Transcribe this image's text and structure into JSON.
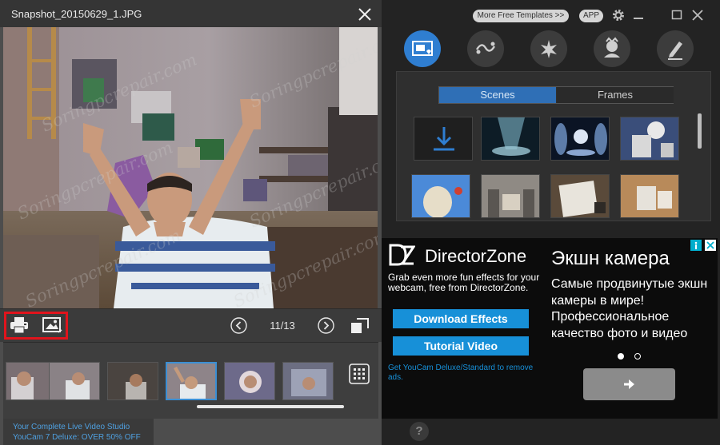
{
  "viewer": {
    "title": "Snapshot_20150629_1.JPG",
    "counter": "11/13",
    "watermark": "Soringpcrepair.com"
  },
  "promo": {
    "line1": "Your Complete Live Video Studio",
    "line2": "YouCam 7 Deluxe: OVER 50% OFF"
  },
  "header": {
    "more_templates": "More Free Templates >>",
    "app": "APP"
  },
  "effects": {
    "tabs": [
      "Scenes",
      "Frames"
    ],
    "active_tab": "Scenes"
  },
  "ad": {
    "brand": "DirectorZone",
    "description": "Grab even more fun effects for your webcam, free from DirectorZone.",
    "download_button": "Download Effects",
    "tutorial_button": "Tutorial Video",
    "link": "Get YouCam Deluxe/Standard to remove ads.",
    "title": "Экшн камера",
    "body": "Самые продвинутые экшн камеры в мире! Профессиональное качество фото и видео"
  },
  "help": {
    "label": "?"
  },
  "icons": {
    "close": "close-icon",
    "print": "print-icon",
    "image": "image-icon",
    "prev": "chevron-left-icon",
    "next": "chevron-right-icon",
    "fit": "fit-screen-icon",
    "grid": "grid-icon",
    "settings": "gear-icon",
    "download": "download-icon"
  },
  "colors": {
    "accent": "#2f7ed1",
    "ad_button": "#1790d8",
    "highlight": "#e0141c"
  }
}
